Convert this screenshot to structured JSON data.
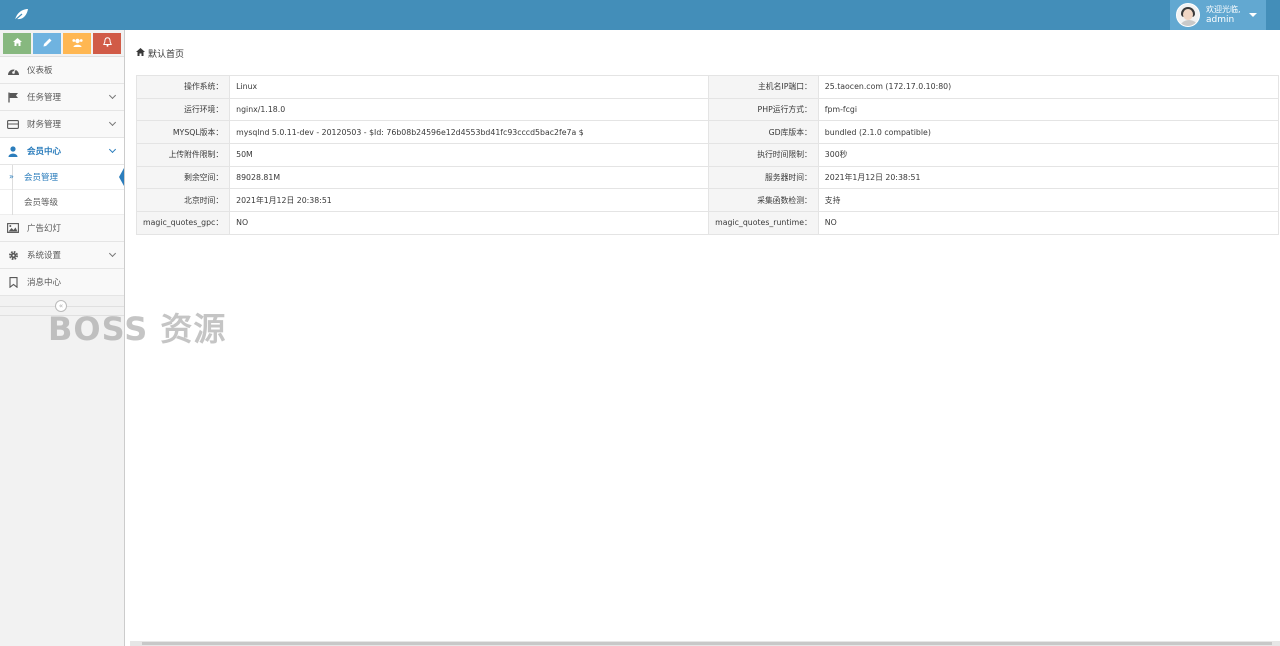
{
  "colors": {
    "navbar": "#438eb9",
    "user_box": "#62a8d1",
    "accent": "#2b7dbc"
  },
  "header": {
    "brand_icon": "leaf-icon",
    "user": {
      "welcome": "欢迎光临,",
      "name": "admin",
      "avatar_icon": "user-avatar"
    }
  },
  "shortcuts": [
    {
      "icon": "home-icon",
      "color": "#87b87f"
    },
    {
      "icon": "pencil-icon",
      "color": "#6fb3e0"
    },
    {
      "icon": "users-icon",
      "color": "#ffb752"
    },
    {
      "icon": "bell-icon",
      "color": "#d15b47"
    }
  ],
  "sidebar": {
    "items": [
      {
        "label": "仪表板",
        "icon": "dashboard-icon"
      },
      {
        "label": "任务管理",
        "icon": "flag-icon"
      },
      {
        "label": "财务管理",
        "icon": "wallet-icon"
      },
      {
        "label": "会员中心",
        "icon": "user-icon",
        "open": true,
        "children": [
          {
            "label": "会员管理",
            "active": true
          },
          {
            "label": "会员等级"
          }
        ]
      },
      {
        "label": "广告幻灯",
        "icon": "picture-icon"
      },
      {
        "label": "系统设置",
        "icon": "gear-icon"
      },
      {
        "label": "消息中心",
        "icon": "bookmark-icon"
      }
    ],
    "collapse_icon": "double-chevron-left-icon"
  },
  "breadcrumb": {
    "home_icon": "home-icon",
    "label": "默认首页"
  },
  "info_rows": [
    {
      "k1": "操作系统：",
      "v1": "Linux",
      "k2": "主机名IP端口：",
      "v2": "25.taocen.com (172.17.0.10:80)"
    },
    {
      "k1": "运行环境：",
      "v1": "nginx/1.18.0",
      "k2": "PHP运行方式：",
      "v2": "fpm-fcgi"
    },
    {
      "k1": "MYSQL版本：",
      "v1": "mysqlnd 5.0.11-dev - 20120503 - $Id: 76b08b24596e12d4553bd41fc93cccd5bac2fe7a $",
      "k2": "GD库版本：",
      "v2": "bundled (2.1.0 compatible)"
    },
    {
      "k1": "上传附件限制：",
      "v1": "50M",
      "k2": "执行时间限制：",
      "v2": "300秒"
    },
    {
      "k1": "剩余空间：",
      "v1": "89028.81M",
      "k2": "服务器时间：",
      "v2": "2021年1月12日 20:38:51"
    },
    {
      "k1": "北京时间：",
      "v1": "2021年1月12日 20:38:51",
      "k2": "采集函数检测：",
      "v2": "支持"
    },
    {
      "k1": "magic_quotes_gpc：",
      "v1": "NO",
      "k2": "magic_quotes_runtime：",
      "v2": "NO"
    }
  ],
  "watermark": "BOSS 资源"
}
